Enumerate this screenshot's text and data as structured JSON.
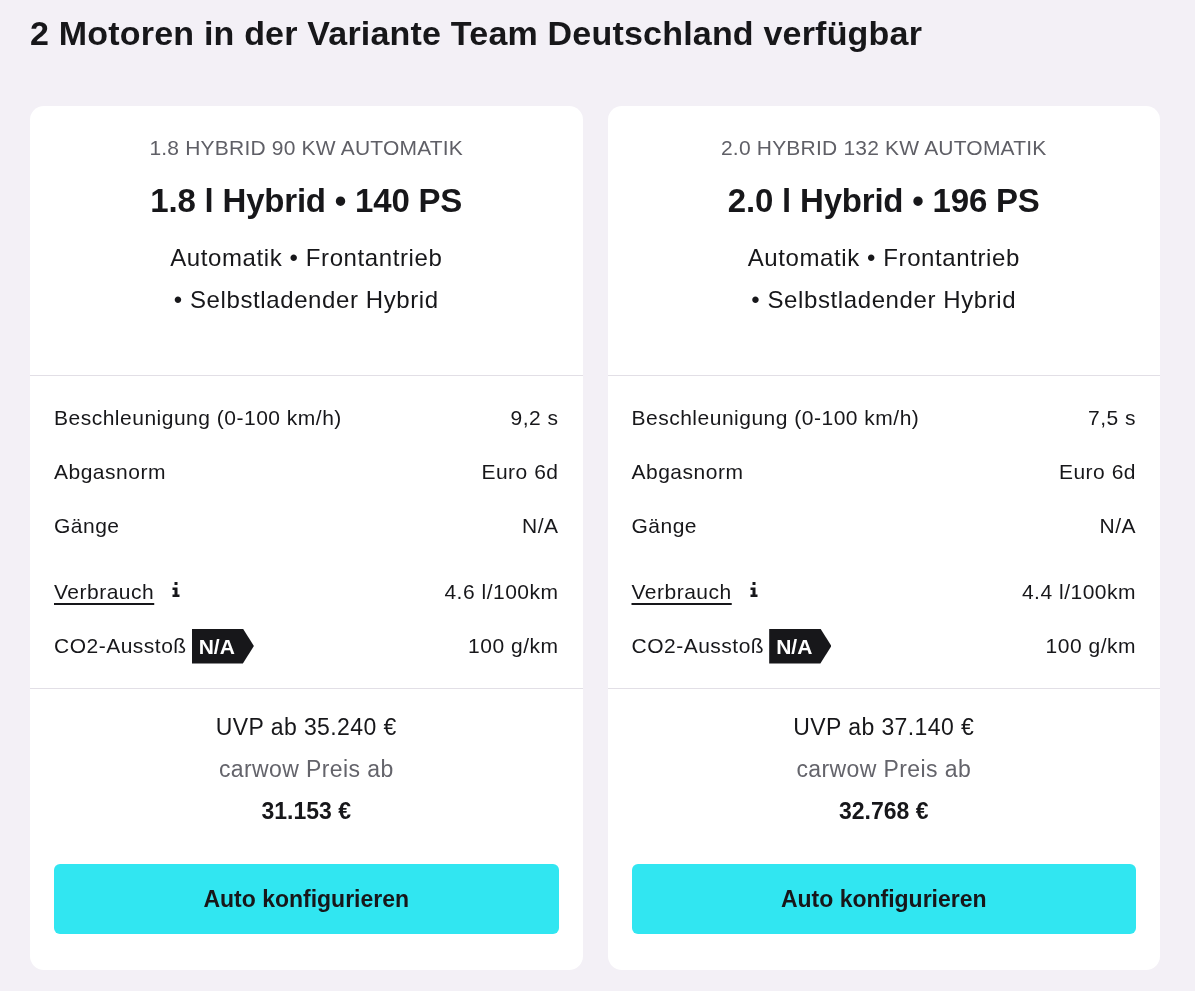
{
  "heading": "2 Motoren in der Variante Team Deutschland verfügbar",
  "engines": [
    {
      "code": "1.8 HYBRID 90 KW AUTOMATIK",
      "title": "1.8 l Hybrid • 140 PS",
      "description_lines": [
        "Automatik • Frontantrieb",
        "• Selbstladender Hybrid"
      ],
      "specs": [
        {
          "kind": "plain",
          "label": "Beschleunigung (0-100 km/h)",
          "value": "9,2 s"
        },
        {
          "kind": "plain",
          "label": "Abgasnorm",
          "value": "Euro 6d"
        },
        {
          "kind": "plain",
          "label": "Gänge",
          "value": "N/A"
        },
        {
          "kind": "link",
          "label": "Verbrauch",
          "value": "4.6 l/100km"
        },
        {
          "kind": "badge",
          "label": "CO2-Ausstoß",
          "badge": "N/A",
          "value": "100 g/km"
        }
      ],
      "msrp": "UVP ab 35.240 €",
      "offer_label": "carwow Preis ab",
      "offer_price": "31.153 €",
      "button": "Auto konfigurieren"
    },
    {
      "code": "2.0 HYBRID 132 KW AUTOMATIK",
      "title": "2.0 l Hybrid • 196 PS",
      "description_lines": [
        "Automatik • Frontantrieb",
        "• Selbstladender Hybrid"
      ],
      "specs": [
        {
          "kind": "plain",
          "label": "Beschleunigung (0-100 km/h)",
          "value": "7,5 s"
        },
        {
          "kind": "plain",
          "label": "Abgasnorm",
          "value": "Euro 6d"
        },
        {
          "kind": "plain",
          "label": "Gänge",
          "value": "N/A"
        },
        {
          "kind": "link",
          "label": "Verbrauch",
          "value": "4.4 l/100km"
        },
        {
          "kind": "badge",
          "label": "CO2-Ausstoß",
          "badge": "N/A",
          "value": "100 g/km"
        }
      ],
      "msrp": "UVP ab 37.140 €",
      "offer_label": "carwow Preis ab",
      "offer_price": "32.768 €",
      "button": "Auto konfigurieren"
    }
  ]
}
